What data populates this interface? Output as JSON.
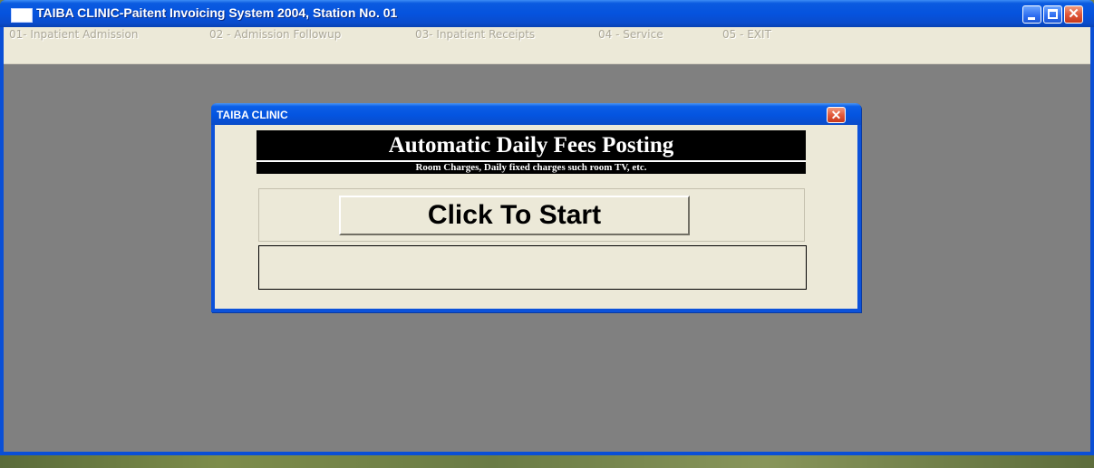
{
  "window": {
    "title": "TAIBA CLINIC-Paitent Invoicing System 2004, Station No. 01",
    "controls": {
      "minimize": "_",
      "maximize": "□",
      "close": "✕"
    }
  },
  "menu": {
    "items": [
      "01- Inpatient Admission",
      "02 - Admission Followup",
      "03- Inpatient Receipts",
      "04 - Service",
      "05 -  EXIT"
    ]
  },
  "dialog": {
    "title": "TAIBA CLINIC",
    "close": "✕",
    "banner_title": "Automatic Daily Fees Posting",
    "banner_subtitle": "Room Charges, Daily fixed charges such room TV, etc.",
    "start_button": "Click To Start",
    "status_text": ""
  },
  "colors": {
    "titlebar": "#0553de",
    "client": "#ece9d8",
    "mdi_background": "#808080",
    "banner": "#000000",
    "close_button": "#e0573a",
    "menu_disabled_text": "#aca899"
  },
  "icons": [
    "app-icon",
    "minimize-icon",
    "maximize-icon",
    "close-icon"
  ]
}
